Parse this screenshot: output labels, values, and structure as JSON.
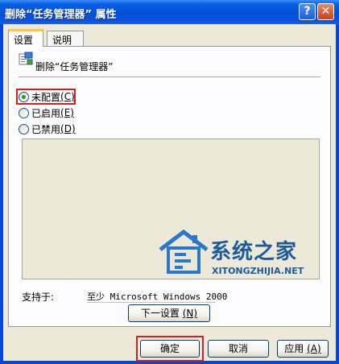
{
  "window": {
    "title": "删除“任务管理器” 属性",
    "help_button": "?",
    "close_button": "✕"
  },
  "tabs": [
    {
      "label": "设置",
      "active": true
    },
    {
      "label": "说明",
      "active": false
    }
  ],
  "policy": {
    "icon": "policy-setting-icon",
    "name": "删除“任务管理器”"
  },
  "options": [
    {
      "label": "未配置",
      "accel": "(C)",
      "checked": true
    },
    {
      "label": "已启用",
      "accel": "(E)",
      "checked": false
    },
    {
      "label": "已禁用",
      "accel": "(D)",
      "checked": false
    }
  ],
  "support": {
    "label": "支持于:",
    "value": "至少 Microsoft Windows 2000"
  },
  "buttons": {
    "next_setting": "下一设置",
    "next_setting_accel": "(N)",
    "ok": "确定",
    "cancel": "取消",
    "apply": "应用",
    "apply_accel": "(A)"
  },
  "watermark": {
    "logo_icon": "house-logo-icon",
    "text_cn": "系统之家",
    "text_en": "XITONGZHIJIA.NET"
  },
  "colors": {
    "title_bar": "#0a52de",
    "highlight_border": "#d41f1f",
    "radio_checked": "#21a121",
    "tab_active_accent": "#ffc83c"
  }
}
